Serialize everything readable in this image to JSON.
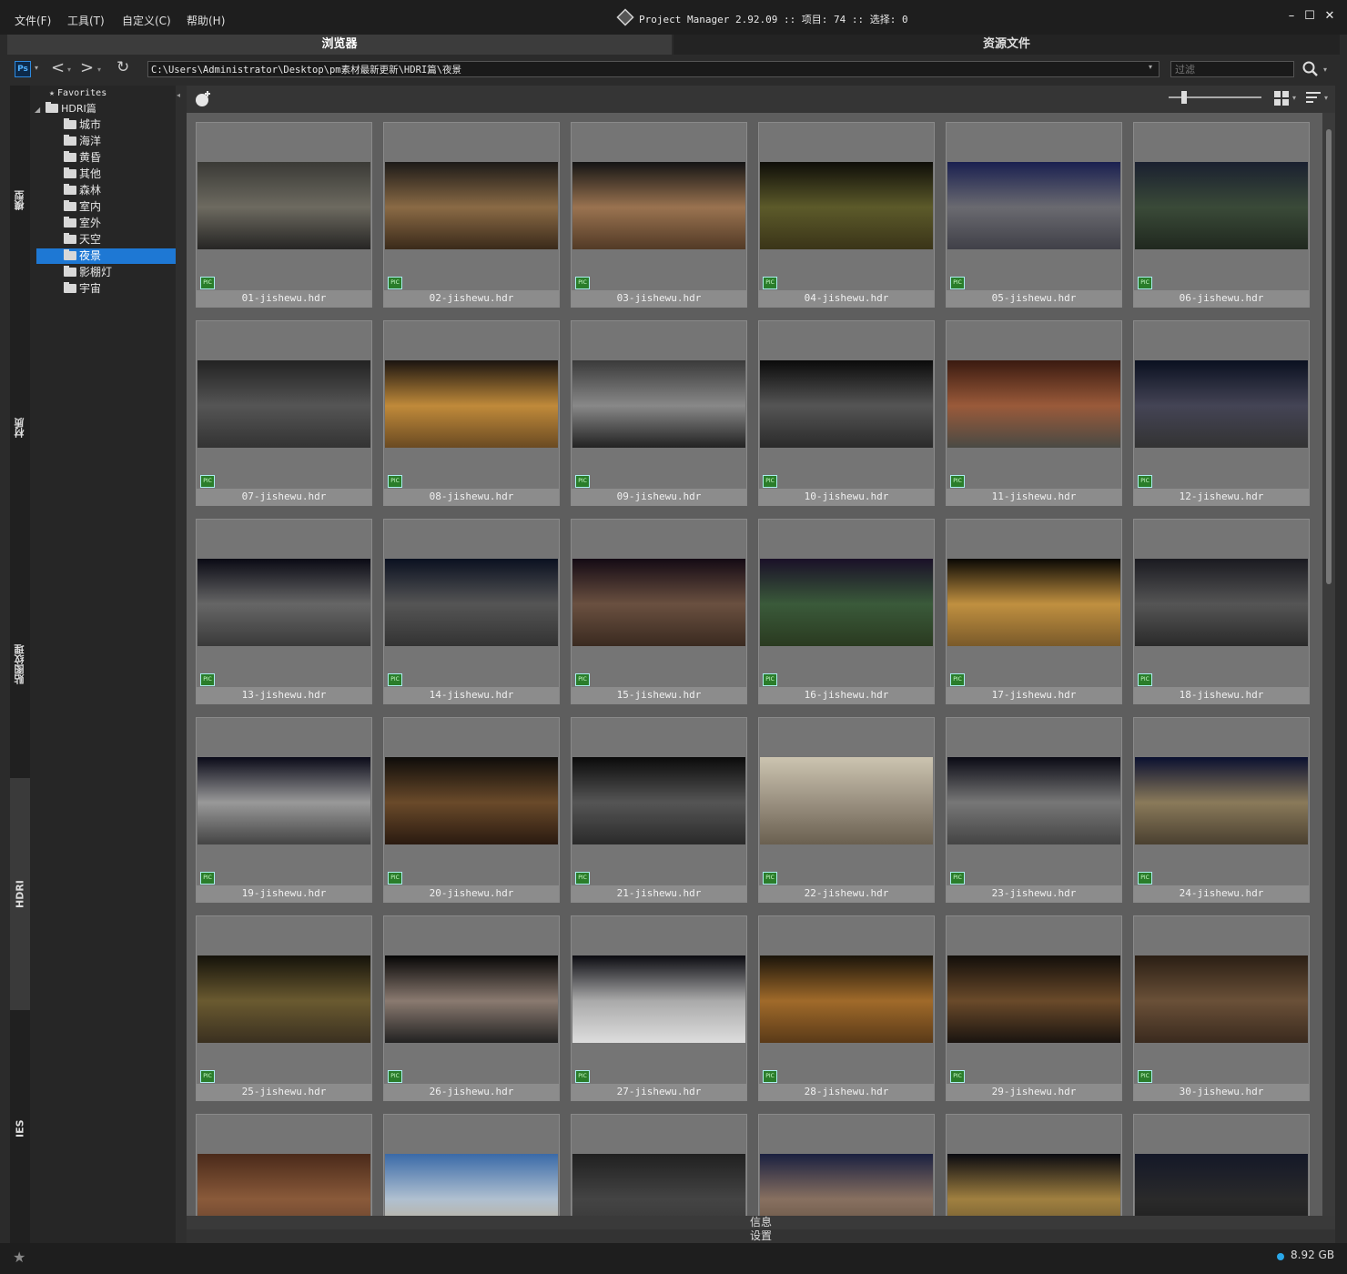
{
  "menu": [
    "文件(F)",
    "工具(T)",
    "自定义(C)",
    "帮助(H)"
  ],
  "title": "Project Manager 2.92.09  :: 项目: 74  :: 选择: 0",
  "window_controls": {
    "minimize": "–",
    "maximize": "☐",
    "close": "✕"
  },
  "tabs": {
    "browser": "浏览器",
    "assets": "资源文件"
  },
  "toolbar": {
    "ps_label": "Ps",
    "path": "C:\\Users\\Administrator\\Desktop\\pm素材最新更新\\HDRI篇\\夜景",
    "filter_placeholder": "过滤"
  },
  "vertical_tabs": [
    "模型",
    "材质",
    "贴图纹理",
    "HDRI",
    "IES"
  ],
  "tree": {
    "favorites": "Favorites",
    "root": "HDRI篇",
    "children": [
      "城市",
      "海洋",
      "黄昏",
      "其他",
      "森林",
      "室内",
      "室外",
      "天空",
      "夜景",
      "影棚灯",
      "宇宙"
    ],
    "selected": "夜景"
  },
  "files": [
    "01-jishewu.hdr",
    "02-jishewu.hdr",
    "03-jishewu.hdr",
    "04-jishewu.hdr",
    "05-jishewu.hdr",
    "06-jishewu.hdr",
    "07-jishewu.hdr",
    "08-jishewu.hdr",
    "09-jishewu.hdr",
    "10-jishewu.hdr",
    "11-jishewu.hdr",
    "12-jishewu.hdr",
    "13-jishewu.hdr",
    "14-jishewu.hdr",
    "15-jishewu.hdr",
    "16-jishewu.hdr",
    "17-jishewu.hdr",
    "18-jishewu.hdr",
    "19-jishewu.hdr",
    "20-jishewu.hdr",
    "21-jishewu.hdr",
    "22-jishewu.hdr",
    "23-jishewu.hdr",
    "24-jishewu.hdr",
    "25-jishewu.hdr",
    "26-jishewu.hdr",
    "27-jishewu.hdr",
    "28-jishewu.hdr",
    "29-jishewu.hdr",
    "30-jishewu.hdr",
    "",
    "",
    "",
    "",
    "",
    ""
  ],
  "badge_label": "PIC",
  "bottom": {
    "info": "信息",
    "settings": "设置"
  },
  "status": {
    "disk": "8.92 GB",
    "disk_color": "#2aa7e8"
  }
}
